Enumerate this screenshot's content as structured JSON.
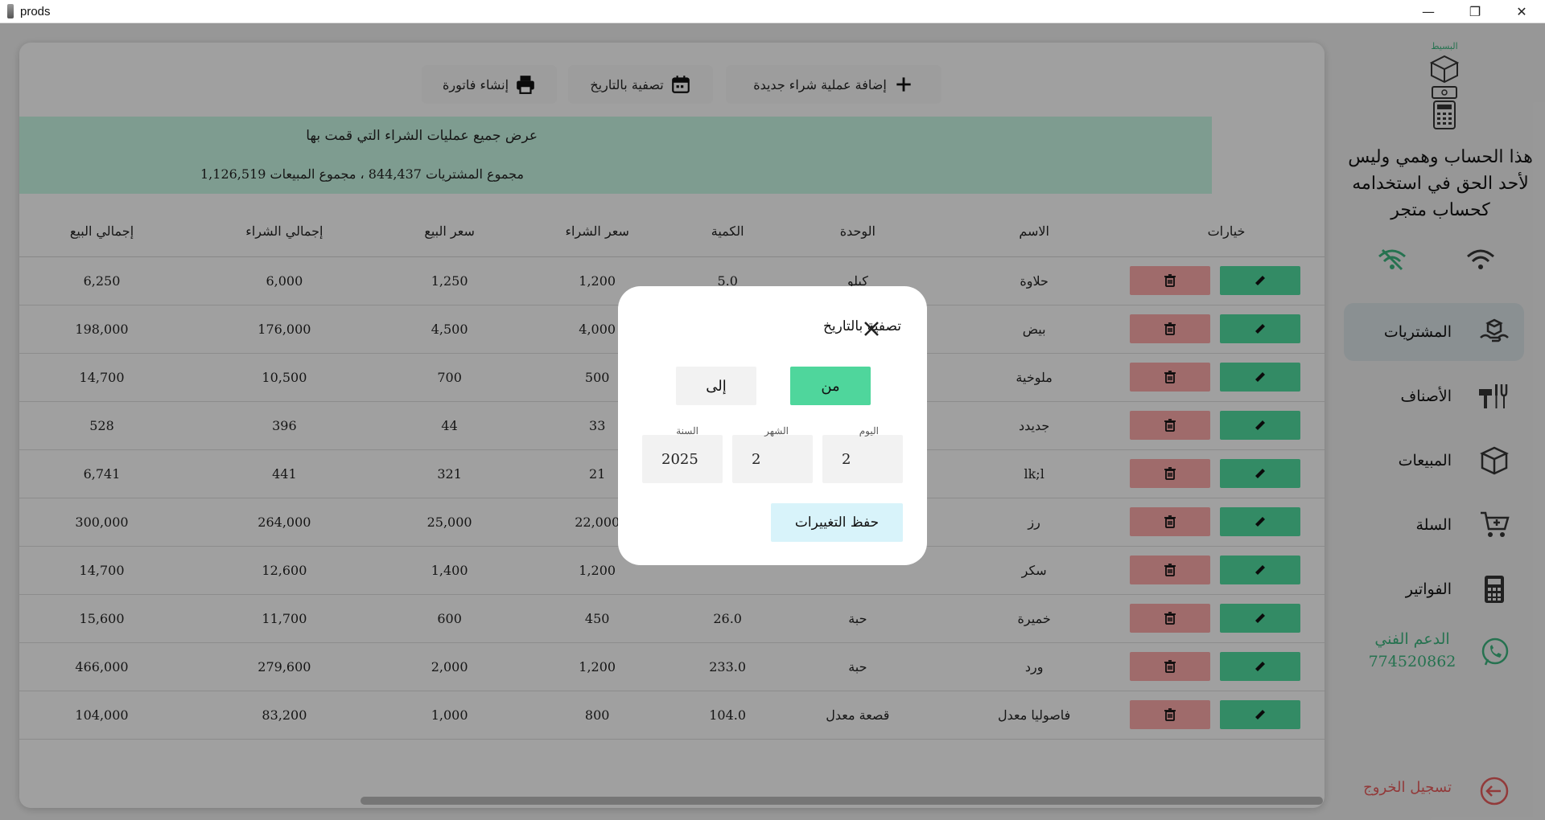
{
  "window": {
    "title": "prods",
    "minimize": "—",
    "maximize": "❐",
    "close": "✕"
  },
  "toolbar": {
    "add_purchase": "إضافة عملية شراء جديدة",
    "filter_by_date": "تصفية بالتاريخ",
    "create_invoice": "إنشاء فاتورة"
  },
  "info": {
    "line1": "عرض جميع عمليات الشراء التي قمت بها",
    "line2": "مجموع المشتريات 844,437 ، مجموع المبيعات 1,126,519"
  },
  "table": {
    "headers": [
      "خيارات",
      "الاسم",
      "الوحدة",
      "الكمية",
      "سعر الشراء",
      "سعر البيع",
      "إجمالي الشراء",
      "إجمالي البيع"
    ],
    "rows": [
      {
        "name": "حلاوة",
        "unit": "كيلو",
        "qty": "5.0",
        "buy": "1,200",
        "sell": "1,250",
        "total_buy": "6,000",
        "total_sell": "6,250"
      },
      {
        "name": "بيض",
        "unit": "",
        "qty": "",
        "buy": "4,000",
        "sell": "4,500",
        "total_buy": "176,000",
        "total_sell": "198,000"
      },
      {
        "name": "ملوخية",
        "unit": "",
        "qty": "",
        "buy": "500",
        "sell": "700",
        "total_buy": "10,500",
        "total_sell": "14,700"
      },
      {
        "name": "جديدد",
        "unit": "",
        "qty": "",
        "buy": "33",
        "sell": "44",
        "total_buy": "396",
        "total_sell": "528"
      },
      {
        "name": "lk;l",
        "unit": "",
        "qty": "",
        "buy": "21",
        "sell": "321",
        "total_buy": "441",
        "total_sell": "6,741"
      },
      {
        "name": "رز",
        "unit": "",
        "qty": "",
        "buy": "22,000",
        "sell": "25,000",
        "total_buy": "264,000",
        "total_sell": "300,000"
      },
      {
        "name": "سكر",
        "unit": "",
        "qty": "",
        "buy": "1,200",
        "sell": "1,400",
        "total_buy": "12,600",
        "total_sell": "14,700"
      },
      {
        "name": "خميرة",
        "unit": "حبة",
        "qty": "26.0",
        "buy": "450",
        "sell": "600",
        "total_buy": "11,700",
        "total_sell": "15,600"
      },
      {
        "name": "ورد",
        "unit": "حبة",
        "qty": "233.0",
        "buy": "1,200",
        "sell": "2,000",
        "total_buy": "279,600",
        "total_sell": "466,000"
      },
      {
        "name": "فاصوليا معدل",
        "unit": "قصعة معدل",
        "qty": "104.0",
        "buy": "800",
        "sell": "1,000",
        "total_buy": "83,200",
        "total_sell": "104,000"
      }
    ]
  },
  "sidebar": {
    "logo_name": "البسيط",
    "notice": "هذا الحساب وهمي وليس لأحد الحق في استخدامه كحساب متجر",
    "items": [
      {
        "label": "المشتريات",
        "icon": "purchases-icon"
      },
      {
        "label": "الأصناف",
        "icon": "categories-icon"
      },
      {
        "label": "المبيعات",
        "icon": "sales-box-icon"
      },
      {
        "label": "السلة",
        "icon": "cart-icon"
      },
      {
        "label": "الفواتير",
        "icon": "invoice-calculator-icon"
      }
    ],
    "support_label": "الدعم الفني",
    "support_phone": "774520862",
    "logout": "تسجيل الخروج"
  },
  "modal": {
    "title": "تصفية بالتاريخ",
    "from": "من",
    "to": "إلى",
    "day_label": "اليوم",
    "month_label": "الشهر",
    "year_label": "السنة",
    "day": "2",
    "month": "2",
    "year": "2025",
    "save": "حفظ التغييرات"
  },
  "colors": {
    "accent_green": "#4fd69c",
    "danger_red": "#f4a5a5",
    "info_bg": "#c2f0de",
    "support_green": "#3bb07b"
  }
}
